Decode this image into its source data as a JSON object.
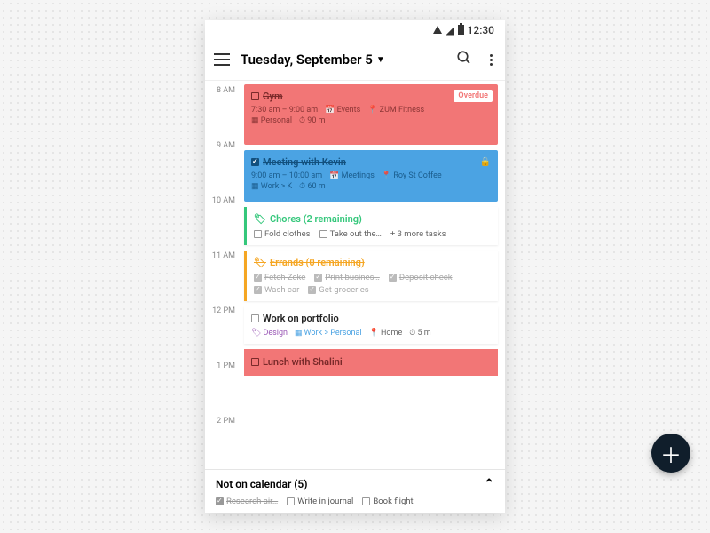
{
  "statusbar": {
    "time": "12:30"
  },
  "header": {
    "title": "Tuesday, September 5"
  },
  "hours": [
    "8 AM",
    "9 AM",
    "10 AM",
    "11 AM",
    "12 PM",
    "1 PM",
    "2 PM"
  ],
  "events": {
    "gym": {
      "title": "Gym",
      "overdue": "Overdue",
      "time": "7:30 am – 9:00 am",
      "cal": "Events",
      "loc": "ZUM Fitness",
      "list": "Personal",
      "dur": "90 m"
    },
    "kevin": {
      "title": "Meeting with Kevin",
      "time": "9:00 am – 10:00 am",
      "cal": "Meetings",
      "loc": "Roy St Coffee",
      "list": "Work > K",
      "dur": "60 m"
    },
    "chores": {
      "title": "Chores (2 remaining)",
      "t1": "Fold clothes",
      "t2": "Take out the…",
      "more": "+ 3 more tasks"
    },
    "errands": {
      "title": "Errands (0 remaining)",
      "t1": "Fetch Zeke",
      "t2": "Print busines…",
      "t3": "Deposit check",
      "t4": "Wash car",
      "t5": "Get groceries"
    },
    "portfolio": {
      "title": "Work on portfolio",
      "tag1": "Design",
      "tag2": "Work > Personal",
      "loc": "Home",
      "dur": "5 m"
    },
    "lunch": {
      "title": "Lunch with Shalini"
    }
  },
  "bottom": {
    "title": "Not on calendar (5)",
    "t1": "Research air…",
    "t2": "Write in journal",
    "t3": "Book flight"
  }
}
